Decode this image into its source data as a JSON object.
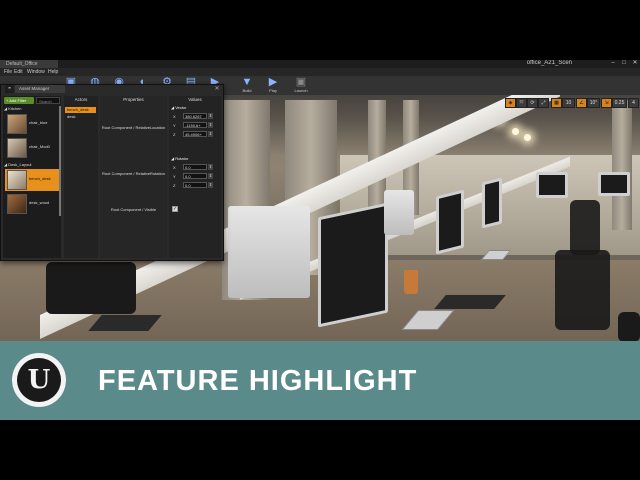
{
  "editor": {
    "window_tab": "Default_Office",
    "project_name": "office_A21_Scen",
    "window_controls": [
      "–",
      "□",
      "✕"
    ],
    "menu": [
      "File",
      "Edit",
      "Window",
      "Help"
    ],
    "toolbar": [
      {
        "icon": "save-icon",
        "label": "Save"
      },
      {
        "icon": "source-control-icon",
        "label": ""
      },
      {
        "icon": "content-icon",
        "label": ""
      },
      {
        "icon": "marketplace-icon",
        "label": ""
      },
      {
        "icon": "settings-icon",
        "label": ""
      },
      {
        "icon": "blueprints-icon",
        "label": ""
      },
      {
        "icon": "cinematics-icon",
        "label": ""
      },
      {
        "icon": "build-icon",
        "label": "Build"
      },
      {
        "icon": "play-icon",
        "label": "Play"
      },
      {
        "icon": "launch-icon",
        "label": "Launch"
      }
    ],
    "viewport_tools": [
      "◈",
      "⤧",
      "⟳",
      "⤢",
      "▦",
      "10",
      "∠",
      "10°",
      "⇲",
      "0.25",
      "4"
    ]
  },
  "property_matrix": {
    "tab_label": "Asset Manager",
    "add_filter_label": "+ Add Filter",
    "search_placeholder": "Search",
    "groups": [
      {
        "name": "◢ Kitchen",
        "assets": [
          {
            "name": "chair_blue",
            "selected": false
          },
          {
            "name": "chair_Mod0",
            "selected": false
          }
        ]
      },
      {
        "name": "◢ Desk_Layout",
        "assets": [
          {
            "name": "bench_desk",
            "selected": true
          },
          {
            "name": "desk_wood",
            "selected": false
          }
        ]
      }
    ],
    "actors_header": "Actors",
    "actors": [
      {
        "name": "bench_desk",
        "selected": true
      },
      {
        "name": "desk",
        "selected": false
      }
    ],
    "properties_header": "Properties",
    "values_header": "Values",
    "properties": [
      "Root Component / RelativeLocation",
      "Root Component / RelativeRotation",
      "Root Component / Visible"
    ],
    "location": {
      "header": "◢ Vector",
      "rows": [
        {
          "axis": "X",
          "value": "380.6267"
        },
        {
          "axis": "Y",
          "value": "-1150.6+"
        },
        {
          "axis": "Z",
          "value": "45.4906+"
        }
      ]
    },
    "rotation": {
      "header": "◢ Rotator",
      "rows": [
        {
          "axis": "X",
          "value": "0.0"
        },
        {
          "axis": "Y",
          "value": "0.0"
        },
        {
          "axis": "Z",
          "value": "0.0"
        }
      ]
    },
    "visible_checked": "✓"
  },
  "banner": {
    "logo_letter": "U",
    "title": "FEATURE HIGHLIGHT",
    "color": "#5b8a8a"
  }
}
